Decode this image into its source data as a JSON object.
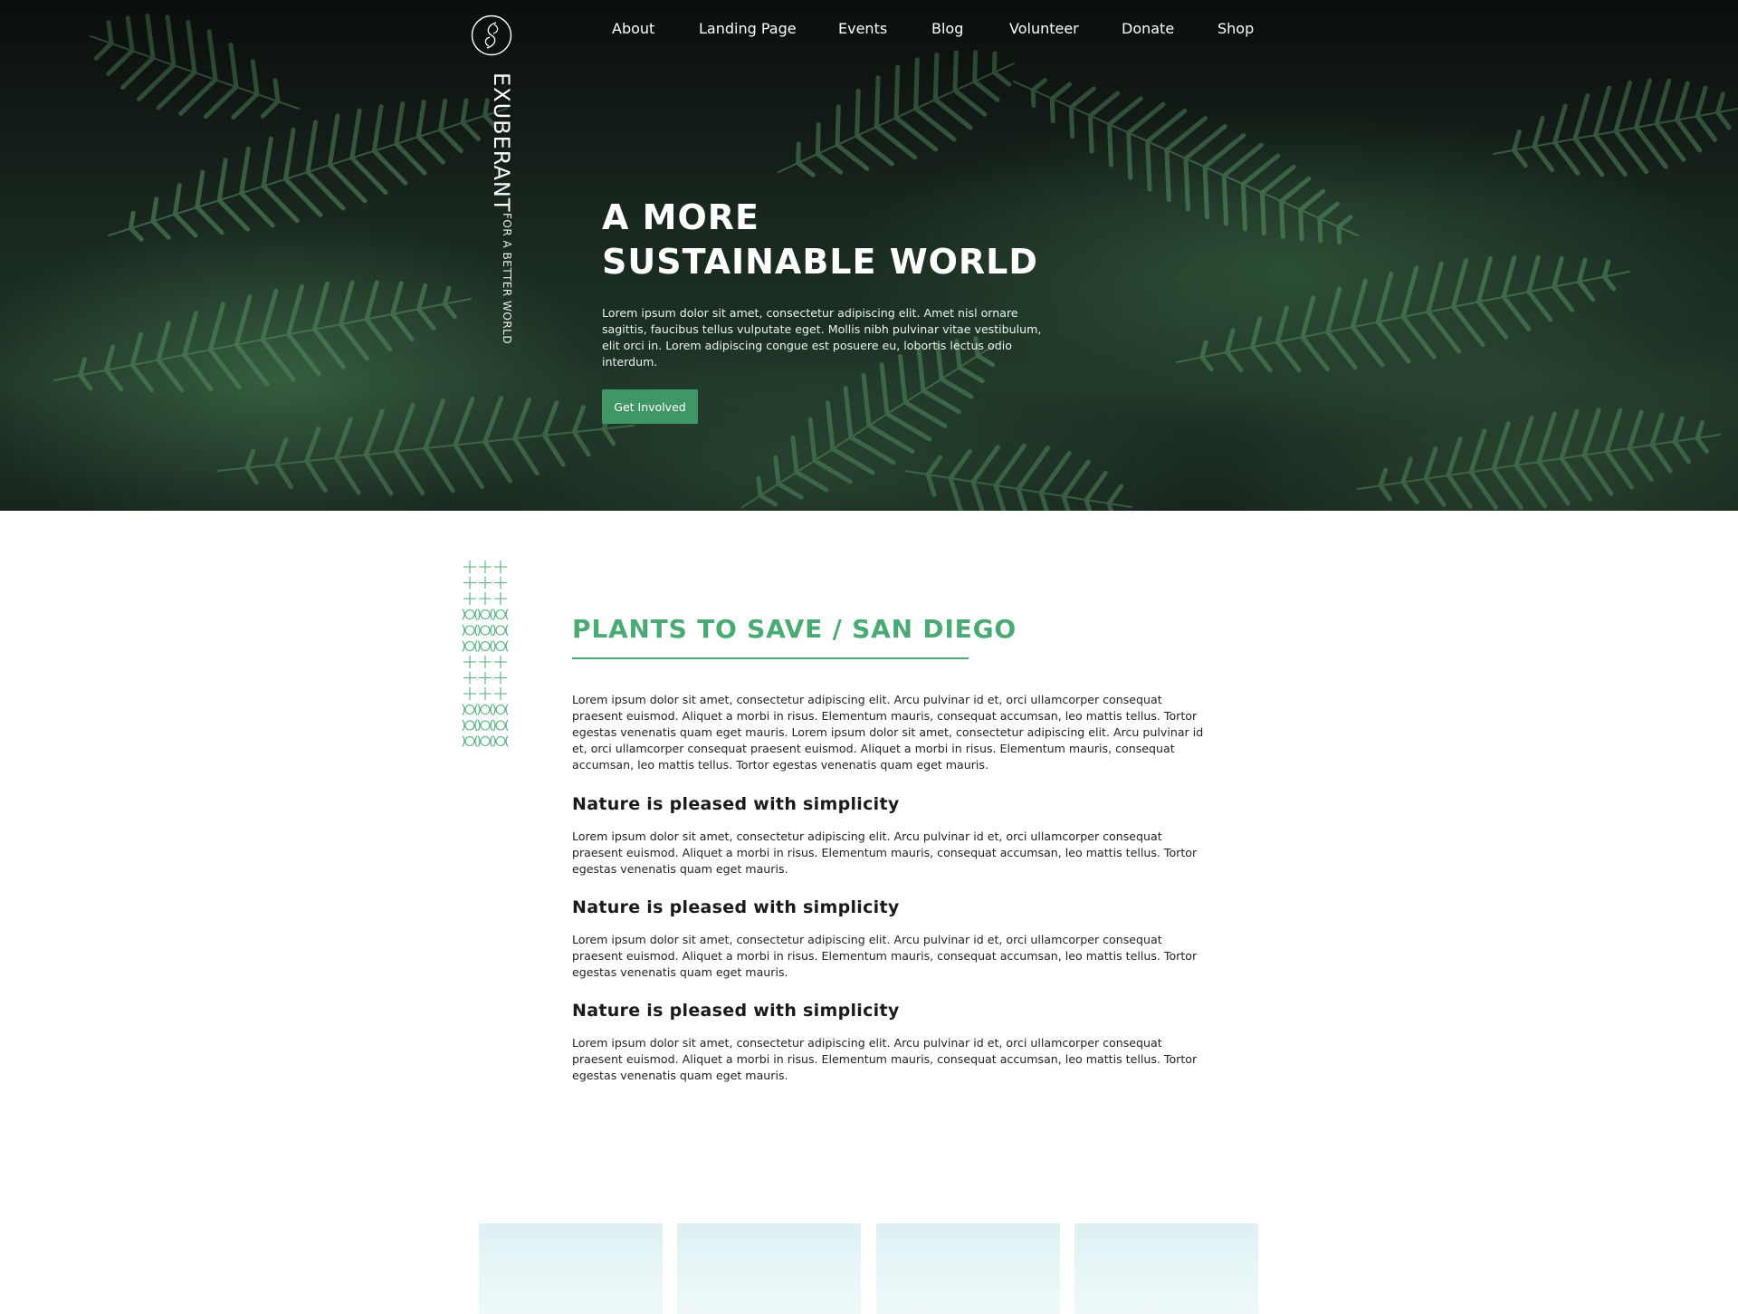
{
  "brand": {
    "name": "EXUBERANT",
    "tagline": "FOR A BETTER WORLD",
    "logo_icon": "leaf-circle-icon"
  },
  "nav": {
    "items": [
      "About",
      "Landing Page",
      "Events",
      "Blog",
      "Volunteer",
      "Donate",
      "Shop"
    ]
  },
  "hero": {
    "title_line1": "A MORE",
    "title_line2": "SUSTAINABLE WORLD",
    "text": "Lorem ipsum dolor sit amet, consectetur adipiscing elit. Amet nisl ornare sagittis, faucibus tellus vulputate eget. Mollis nibh pulvinar vitae vestibulum, elit orci in. Lorem adipiscing congue est posuere eu, lobortis lectus odio interdum.",
    "button_label": "Get Involved"
  },
  "section": {
    "title": "PLANTS TO SAVE / SAN DIEGO",
    "intro": "Lorem ipsum dolor sit amet, consectetur adipiscing elit. Arcu pulvinar id et, orci ullamcorper consequat praesent euismod. Aliquet a morbi in risus. Elementum mauris, consequat accumsan, leo mattis tellus. Tortor egestas venenatis quam eget mauris. Lorem ipsum dolor sit amet, consectetur adipiscing elit. Arcu pulvinar id et, orci ullamcorper consequat praesent euismod. Aliquet a morbi in risus. Elementum mauris, consequat accumsan, leo mattis tellus. Tortor egestas venenatis quam eget mauris.",
    "blocks": [
      {
        "heading": "Nature is pleased with simplicity",
        "text": "Lorem ipsum dolor sit amet, consectetur adipiscing elit. Arcu pulvinar id et, orci ullamcorper consequat praesent euismod. Aliquet a morbi in risus. Elementum mauris, consequat accumsan, leo mattis tellus. Tortor egestas venenatis quam eget mauris."
      },
      {
        "heading": "Nature is pleased with simplicity",
        "text": "Lorem ipsum dolor sit amet, consectetur adipiscing elit. Arcu pulvinar id et, orci ullamcorper consequat praesent euismod. Aliquet a morbi in risus. Elementum mauris, consequat accumsan, leo mattis tellus. Tortor egestas venenatis quam eget mauris."
      },
      {
        "heading": "Nature is pleased with simplicity",
        "text": "Lorem ipsum dolor sit amet, consectetur adipiscing elit. Arcu pulvinar id et, orci ullamcorper consequat praesent euismod. Aliquet a morbi in risus. Elementum mauris, consequat accumsan, leo mattis tellus. Tortor egestas venenatis quam eget mauris."
      }
    ]
  },
  "colors": {
    "accent_green": "#4aaa74",
    "button_green": "#3f9766",
    "hero_dark": "#101613"
  }
}
